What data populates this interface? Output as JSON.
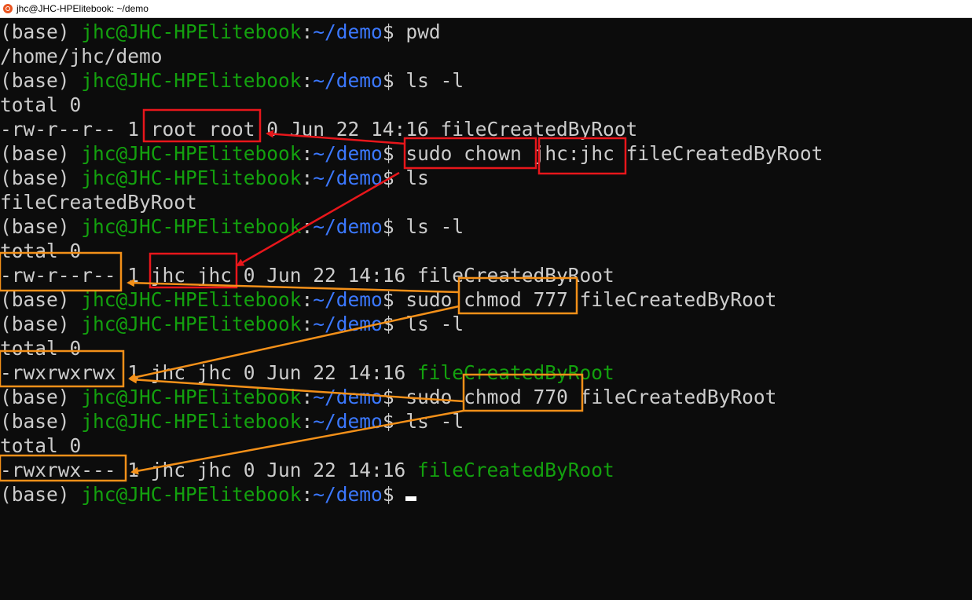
{
  "window": {
    "title": "jhc@JHC-HPElitebook: ~/demo",
    "icon": "ubuntu-icon"
  },
  "prompt": {
    "env": "(base) ",
    "user_host": "jhc@JHC-HPElitebook",
    "sep": ":",
    "path": "~/demo",
    "dollar": "$ "
  },
  "lines": [
    {
      "type": "cmd",
      "cmd": "pwd"
    },
    {
      "type": "out",
      "text": "/home/jhc/demo"
    },
    {
      "type": "cmd",
      "cmd": "ls -l"
    },
    {
      "type": "out",
      "text": "total 0"
    },
    {
      "type": "out",
      "text": "-rw-r--r-- 1 root root 0 Jun 22 14:16 fileCreatedByRoot"
    },
    {
      "type": "cmd",
      "cmd": "sudo chown jhc:jhc fileCreatedByRoot"
    },
    {
      "type": "cmd",
      "cmd": "ls"
    },
    {
      "type": "out",
      "text": "fileCreatedByRoot"
    },
    {
      "type": "cmd",
      "cmd": "ls -l"
    },
    {
      "type": "out",
      "text": "total 0"
    },
    {
      "type": "out",
      "text": "-rw-r--r-- 1 jhc jhc 0 Jun 22 14:16 fileCreatedByRoot"
    },
    {
      "type": "cmd",
      "cmd": "sudo chmod 777 fileCreatedByRoot"
    },
    {
      "type": "cmd",
      "cmd": "ls -l"
    },
    {
      "type": "out",
      "text": "total 0"
    },
    {
      "type": "outfile",
      "text": "-rwxrwxrwx 1 jhc jhc 0 Jun 22 14:16 ",
      "file": "fileCreatedByRoot"
    },
    {
      "type": "cmd",
      "cmd": "sudo chmod 770 fileCreatedByRoot"
    },
    {
      "type": "cmd",
      "cmd": "ls -l"
    },
    {
      "type": "out",
      "text": "total 0"
    },
    {
      "type": "outfile",
      "text": "-rwxrwx--- 1 jhc jhc 0 Jun 22 14:16 ",
      "file": "fileCreatedByRoot"
    },
    {
      "type": "prompt_cursor",
      "cmd": ""
    }
  ],
  "colors": {
    "background": "#0c0c0c",
    "text": "#cccccc",
    "prompt_user": "#13a10e",
    "prompt_path": "#3b78ff",
    "executable_file": "#13a10e",
    "annotation_red": "#e8161b",
    "annotation_orange": "#f39019"
  }
}
